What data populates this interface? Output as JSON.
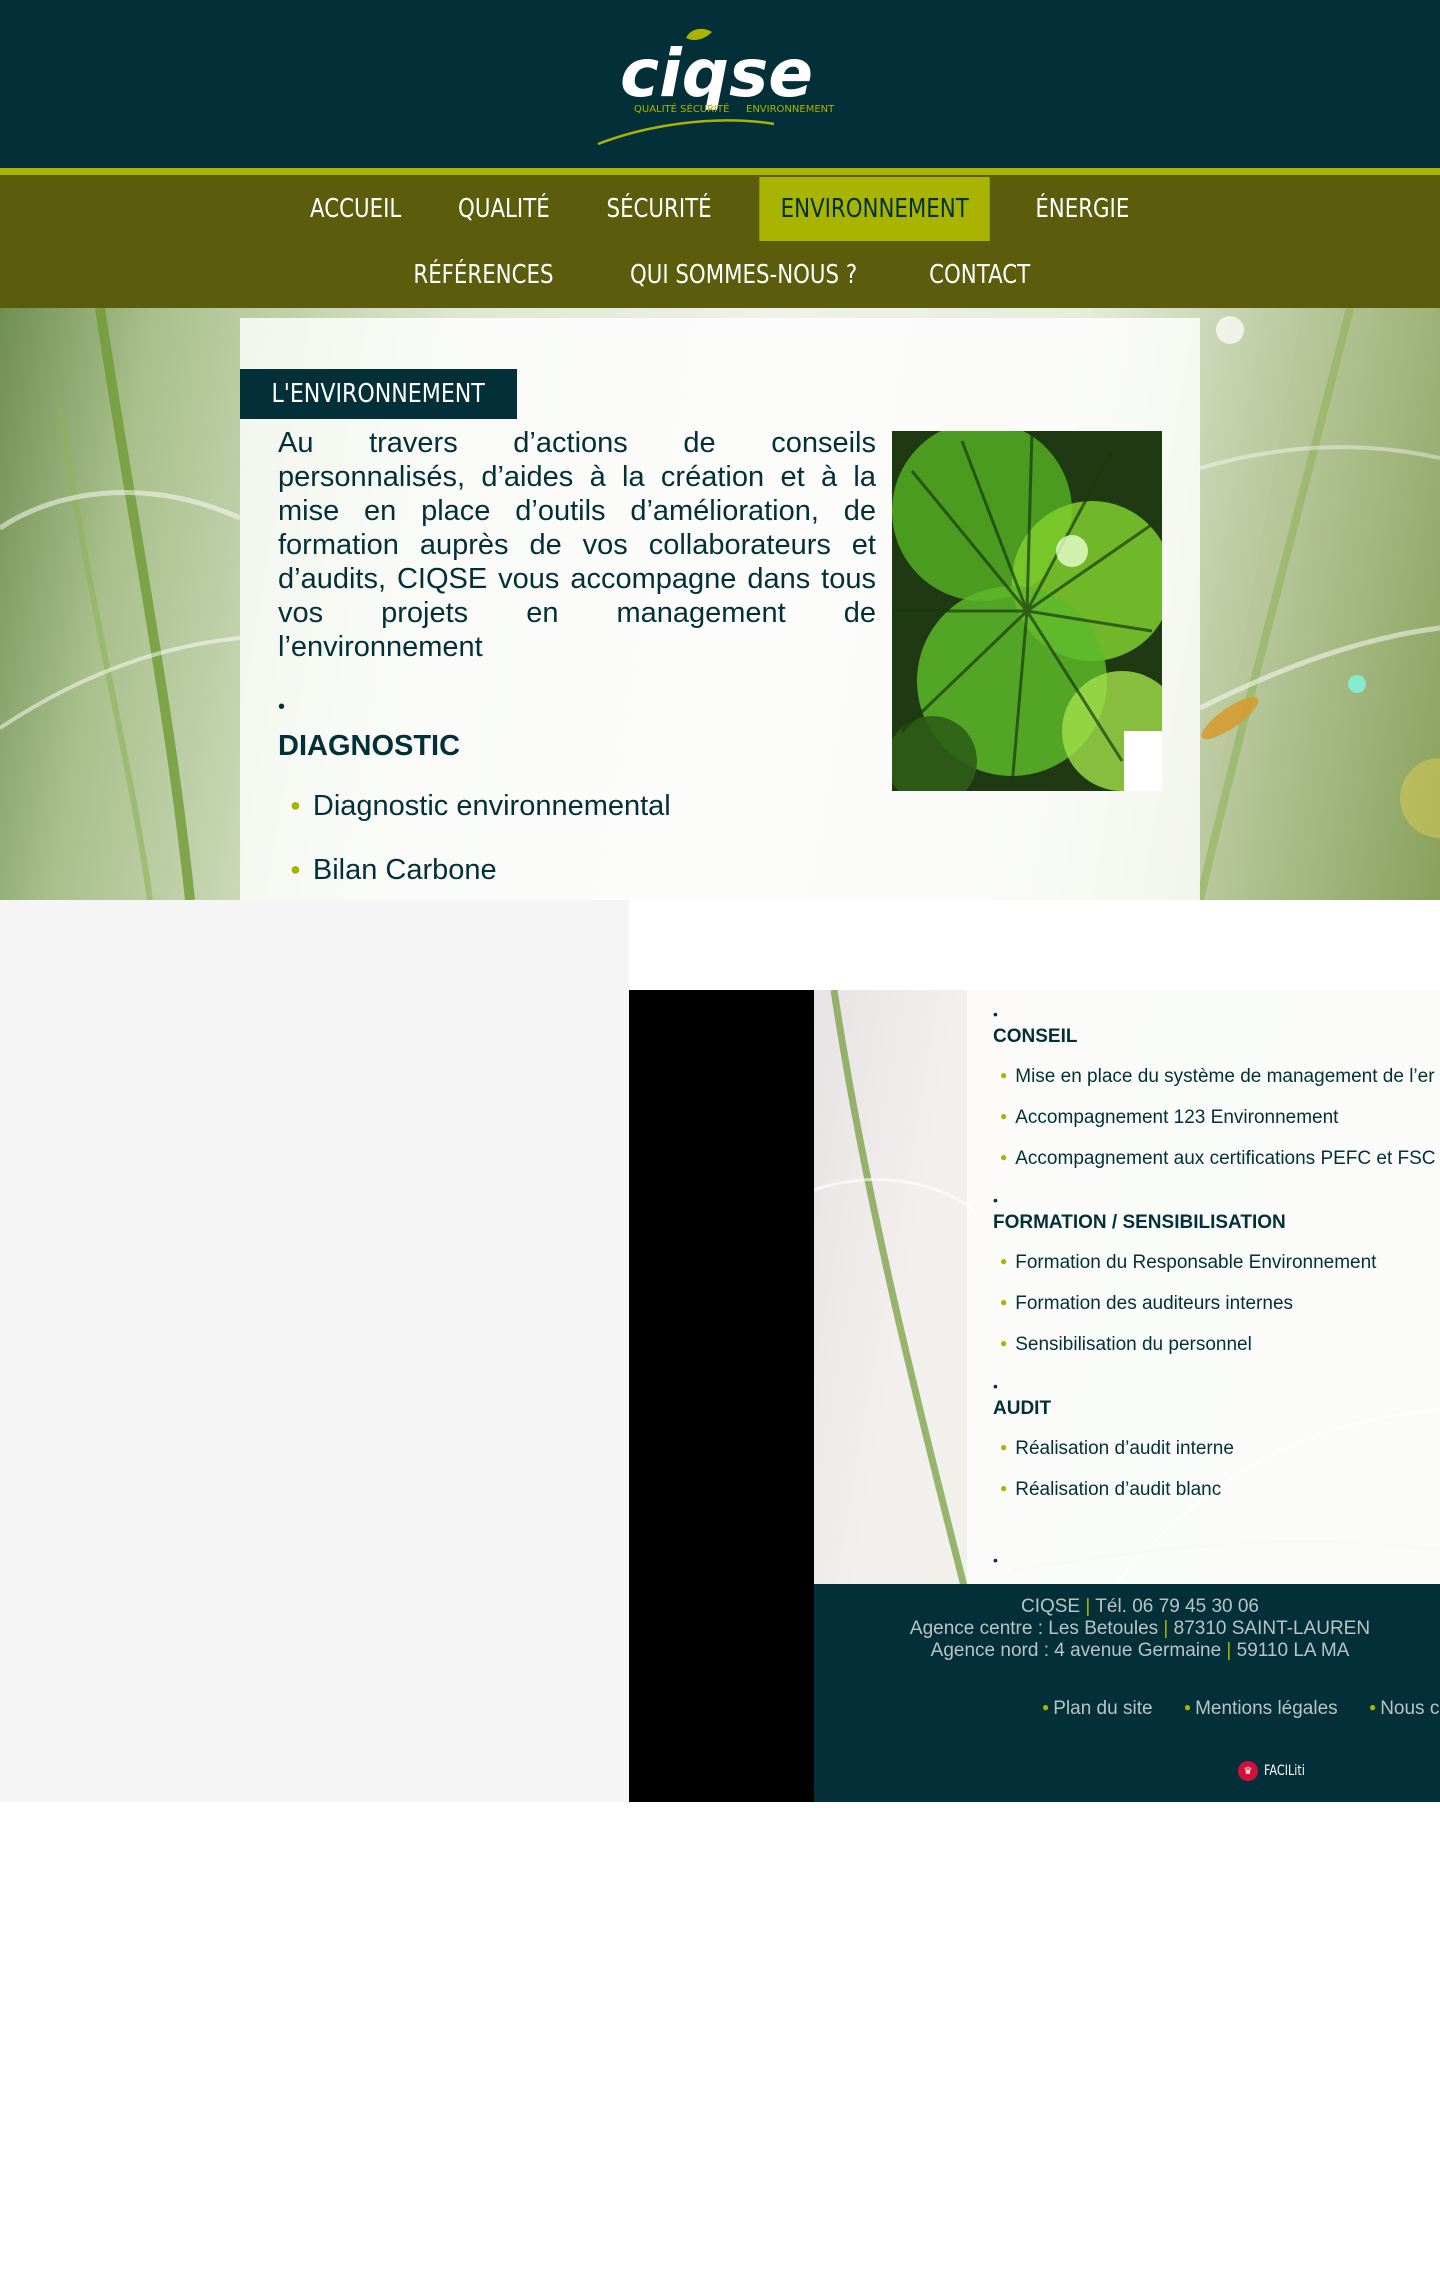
{
  "brand": {
    "logo_text": "ciqse",
    "logo_tagline_1": "QUALITÉ SÉCURITÉ",
    "logo_tagline_2": "ENVIRONNEMENT"
  },
  "nav": {
    "row1": [
      "ACCUEIL",
      "QUALITÉ",
      "SÉCURITÉ",
      "ENVIRONNEMENT",
      "ÉNERGIE"
    ],
    "row2": [
      "RÉFÉRENCES",
      "QUI SOMMES-NOUS ?",
      "CONTACT"
    ],
    "active": "ENVIRONNEMENT"
  },
  "main": {
    "section_title": "L'ENVIRONNEMENT",
    "intro": "Au travers d’actions de conseils personnalisés, d’aides à la création et à la mise en place d’outils d’amélioration, de formation auprès de vos collaborateurs et d’audits, CIQSE vous accompagne dans tous vos projets en management de l’environnement",
    "bullet": "•",
    "diagnostic": {
      "title": "DIAGNOSTIC",
      "items": [
        "Diagnostic environnemental",
        "Bilan Carbone"
      ]
    }
  },
  "lower": {
    "conseil": {
      "title": "CONSEIL",
      "items": [
        "Mise en place du système de management de l’er",
        "Accompagnement 123 Environnement",
        "Accompagnement aux certifications PEFC et FSC"
      ]
    },
    "formation": {
      "title": "FORMATION / SENSIBILISATION",
      "items": [
        "Formation du Responsable Environnement",
        "Formation des auditeurs internes",
        "Sensibilisation du personnel"
      ]
    },
    "audit": {
      "title": "AUDIT",
      "items": [
        "Réalisation d’audit interne",
        "Réalisation d’audit blanc"
      ]
    }
  },
  "footer": {
    "company": "CIQSE",
    "phone": "Tél. 06 79 45 30 06",
    "agence_centre_label": "Agence centre : Les Betoules",
    "agence_centre_city": "87310 SAINT-LAUREN",
    "agence_nord_label": "Agence nord : 4 avenue Germaine",
    "agence_nord_city": "59110 LA MA",
    "separator": "|",
    "links": [
      "Plan du site",
      "Mentions légales",
      "Nous c"
    ],
    "facil_label": "FACILiti"
  },
  "colors": {
    "dark_teal": "#033038",
    "accent_green": "#a8b400",
    "nav_olive": "#5b5d0c"
  }
}
